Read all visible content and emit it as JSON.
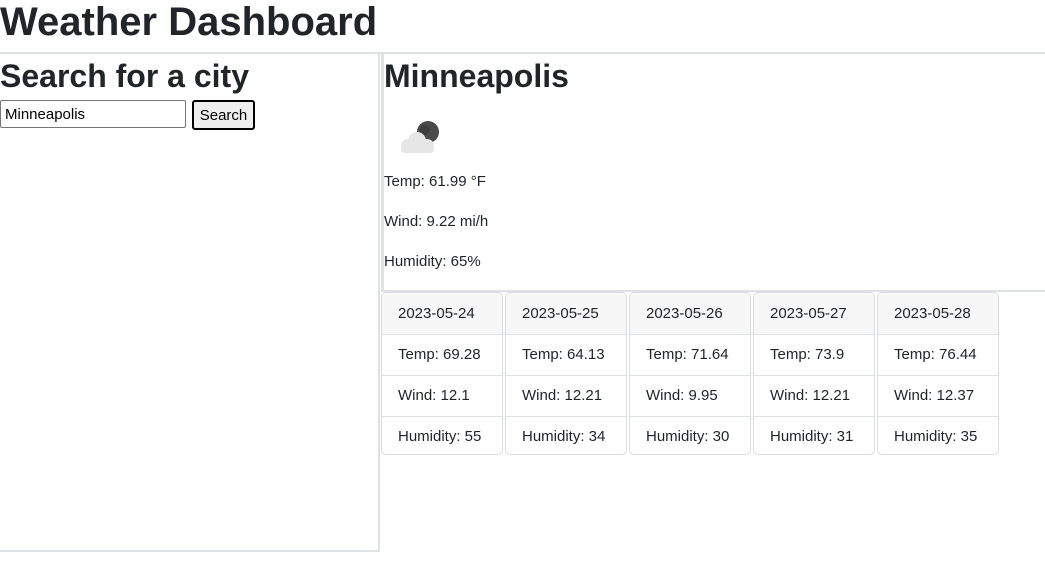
{
  "header": {
    "title": "Weather Dashboard"
  },
  "search": {
    "title": "Search for a city",
    "input_value": "Minneapolis",
    "button_label": "Search"
  },
  "current": {
    "city": "Minneapolis",
    "icon": "partly-cloudy-night-icon",
    "temp": "Temp: 61.99 °F",
    "wind": "Wind: 9.22 mi/h",
    "humidity": "Humidity: 65%"
  },
  "forecast": [
    {
      "date": "2023-05-24",
      "temp": "Temp: 69.28",
      "wind": "Wind: 12.1",
      "humidity": "Humidity: 55"
    },
    {
      "date": "2023-05-25",
      "temp": "Temp: 64.13",
      "wind": "Wind: 12.21",
      "humidity": "Humidity: 34"
    },
    {
      "date": "2023-05-26",
      "temp": "Temp: 71.64",
      "wind": "Wind: 9.95",
      "humidity": "Humidity: 30"
    },
    {
      "date": "2023-05-27",
      "temp": "Temp: 73.9",
      "wind": "Wind: 12.21",
      "humidity": "Humidity: 31"
    },
    {
      "date": "2023-05-28",
      "temp": "Temp: 76.44",
      "wind": "Wind: 12.37",
      "humidity": "Humidity: 35"
    }
  ]
}
